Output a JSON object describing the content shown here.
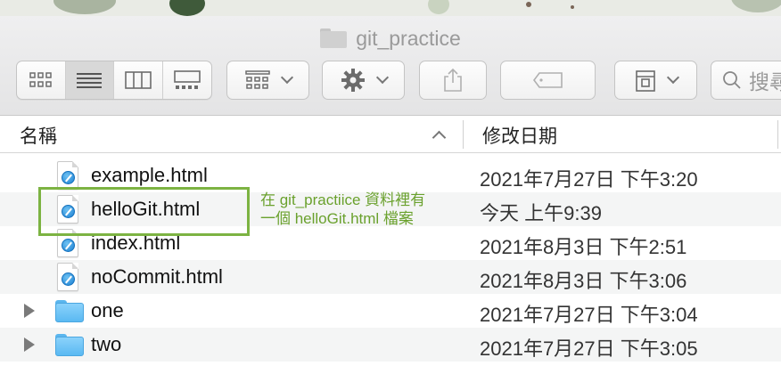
{
  "window": {
    "title": "git_practice"
  },
  "toolbar": {
    "search_placeholder": "搜尋",
    "view_modes": [
      "icon-view",
      "list-view",
      "column-view",
      "gallery-view"
    ],
    "active_view": "list-view"
  },
  "columns": {
    "name": "名稱",
    "date_modified": "修改日期"
  },
  "files": [
    {
      "name": "example.html",
      "date": "2021年7月27日 下午3:20",
      "kind": "html"
    },
    {
      "name": "helloGit.html",
      "date": "今天 上午9:39",
      "kind": "html"
    },
    {
      "name": "index.html",
      "date": "2021年8月3日 下午2:51",
      "kind": "html"
    },
    {
      "name": "noCommit.html",
      "date": "2021年8月3日 下午3:06",
      "kind": "html"
    },
    {
      "name": "one",
      "date": "2021年7月27日 下午3:04",
      "kind": "folder"
    },
    {
      "name": "two",
      "date": "2021年7月27日 下午3:05",
      "kind": "folder"
    }
  ],
  "annotation": {
    "line1": "在 git_practiice 資料裡有",
    "line2": "一個 helloGit.html 檔案",
    "color": "#6aa12d"
  },
  "colors": {
    "highlight_border": "#7cb342",
    "folder_blue": "#5ab9f2",
    "row_alt": "#f4f5f5"
  }
}
